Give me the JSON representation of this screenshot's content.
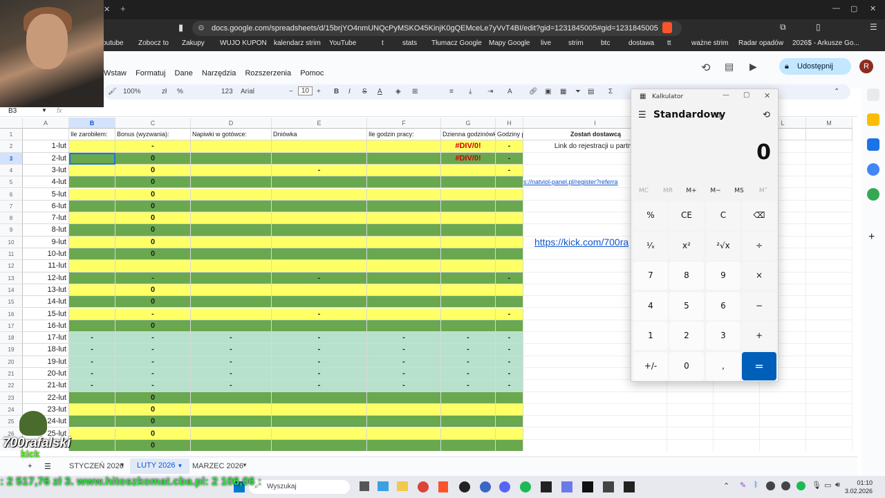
{
  "browser": {
    "url": "docs.google.com/spreadsheets/d/15brjYO4nmUNQcPyMSKO45KinjK0gQEMceLe7yVvT4BI/edit?gid=1231845005#gid=1231845005",
    "bookmarks": [
      "outube",
      "Zobocz to",
      "Zakupy",
      "WUJO KUPON",
      "kalendarz strim",
      "YouTube",
      "t",
      "stats",
      "Tłumacz Google",
      "Mapy Google",
      "live",
      "strim",
      "btc",
      "dostawa",
      "tt",
      "ważne strim",
      "Radar opadów",
      "2026$ - Arkusze Go..."
    ]
  },
  "sheets": {
    "menu": [
      "Wstaw",
      "Formatuj",
      "Dane",
      "Narzędzia",
      "Rozszerzenia",
      "Pomoc"
    ],
    "share_label": "Udostępnij",
    "avatar_letter": "R",
    "zoom": "100%",
    "font": "Arial",
    "font_size": "10",
    "cell_ref": "B3",
    "fx": "fx"
  },
  "columns": [
    "A",
    "B",
    "C",
    "D",
    "E",
    "F",
    "G",
    "H",
    "I",
    "J",
    "K",
    "L",
    "M"
  ],
  "headers": {
    "B": "Ile zarobiłem:",
    "C": "Bonus (wyzwania):",
    "D": "Napiwki w gotówce:",
    "E": "Dniówka",
    "F": "Ile godzin pracy:",
    "G": "Dzienna godzinówka",
    "H": "Godziny p",
    "I": "Zostań dostawcą"
  },
  "rows": [
    {
      "n": "2",
      "a": "1-lut",
      "c": "-",
      "g": "#DIV/0!",
      "h": "-",
      "color": "yellow"
    },
    {
      "n": "3",
      "a": "2-lut",
      "c": "0",
      "g": "#DIV/0!",
      "h": "-",
      "color": "green"
    },
    {
      "n": "4",
      "a": "3-lut",
      "c": "0",
      "e": "-",
      "h": "-",
      "color": "yellow"
    },
    {
      "n": "5",
      "a": "4-lut",
      "c": "0",
      "color": "green"
    },
    {
      "n": "6",
      "a": "5-lut",
      "c": "0",
      "color": "yellow"
    },
    {
      "n": "7",
      "a": "6-lut",
      "c": "0",
      "color": "green"
    },
    {
      "n": "8",
      "a": "7-lut",
      "c": "0",
      "color": "yellow"
    },
    {
      "n": "9",
      "a": "8-lut",
      "c": "0",
      "color": "green"
    },
    {
      "n": "10",
      "a": "9-lut",
      "c": "0",
      "color": "yellow"
    },
    {
      "n": "11",
      "a": "10-lut",
      "c": "0",
      "color": "green"
    },
    {
      "n": "12",
      "a": "11-lut",
      "color": "yellow"
    },
    {
      "n": "13",
      "a": "12-lut",
      "c": "-",
      "e": "-",
      "h": "-",
      "color": "green"
    },
    {
      "n": "14",
      "a": "13-lut",
      "c": "0",
      "color": "yellow"
    },
    {
      "n": "15",
      "a": "14-lut",
      "c": "0",
      "color": "green"
    },
    {
      "n": "16",
      "a": "15-lut",
      "c": "-",
      "e": "-",
      "h": "-",
      "color": "yellow"
    },
    {
      "n": "17",
      "a": "16-lut",
      "c": "0",
      "color": "green"
    },
    {
      "n": "18",
      "a": "17-lut",
      "b": "-",
      "c": "-",
      "d": "-",
      "e": "-",
      "f": "-",
      "g": "-",
      "h": "-",
      "color": "mint"
    },
    {
      "n": "19",
      "a": "18-lut",
      "b": "-",
      "c": "-",
      "d": "-",
      "e": "-",
      "f": "-",
      "g": "-",
      "h": "-",
      "color": "mint"
    },
    {
      "n": "20",
      "a": "19-lut",
      "b": "-",
      "c": "-",
      "d": "-",
      "e": "-",
      "f": "-",
      "g": "-",
      "h": "-",
      "color": "mint"
    },
    {
      "n": "21",
      "a": "20-lut",
      "b": "-",
      "c": "-",
      "d": "-",
      "e": "-",
      "f": "-",
      "g": "-",
      "h": "-",
      "color": "mint"
    },
    {
      "n": "22",
      "a": "21-lut",
      "b": "-",
      "c": "-",
      "d": "-",
      "e": "-",
      "f": "-",
      "g": "-",
      "h": "-",
      "color": "mint"
    },
    {
      "n": "23",
      "a": "22-lut",
      "c": "0",
      "color": "green"
    },
    {
      "n": "24",
      "a": "23-lut",
      "c": "0",
      "color": "yellow"
    },
    {
      "n": "25",
      "a": "24-lut",
      "c": "0",
      "color": "green"
    },
    {
      "n": "26",
      "a": "25-lut",
      "c": "0",
      "color": "yellow"
    },
    {
      "n": "27",
      "a": "",
      "c": "0",
      "color": "green"
    }
  ],
  "side_text": {
    "i2": "Link do rejestracji u partne",
    "i5": "s://natviol-panel.pl/register?referra",
    "i10": "https://kick.com/700ra"
  },
  "colors": {
    "yellow": "#ffff66",
    "green": "#6aa84f",
    "mint": "#b7e1cd",
    "accent": "#005fb8",
    "error": "#cc0000"
  },
  "calculator": {
    "title": "Kalkulator",
    "mode": "Standardowy",
    "display": "0",
    "memory": [
      "MC",
      "MR",
      "M+",
      "M−",
      "MS",
      "M˅"
    ],
    "keys": [
      [
        "%",
        "CE",
        "C",
        "⌫"
      ],
      [
        "¹⁄ₓ",
        "x²",
        "²√x",
        "÷"
      ],
      [
        "7",
        "8",
        "9",
        "×"
      ],
      [
        "4",
        "5",
        "6",
        "−"
      ],
      [
        "1",
        "2",
        "3",
        "+"
      ],
      [
        "+/-",
        "0",
        ",",
        "="
      ]
    ]
  },
  "tabs": [
    "STYCZEŃ 2026",
    "LUTY 2026",
    "MARZEC 2026"
  ],
  "overlay": {
    "ticker": ": 2 517,76 zł    3. www.hitoszkomat.cba.pl: 2 106,06 :",
    "logo_name": "700rafalski",
    "logo_sub": "kick"
  },
  "taskbar": {
    "search": "Wyszukaj",
    "time": "01:10",
    "date": "3.02.2026"
  }
}
